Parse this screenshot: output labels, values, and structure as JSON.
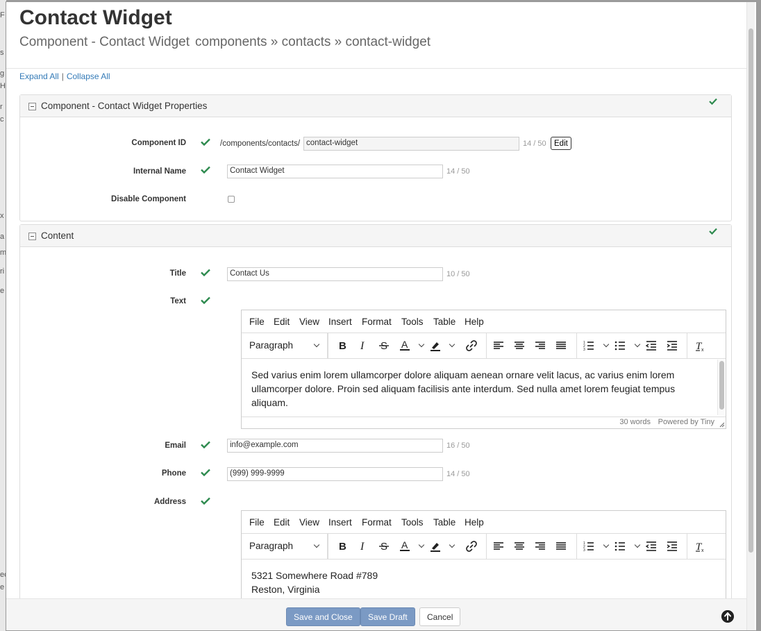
{
  "page": {
    "title": "Contact Widget",
    "subtitle_type": "Component - Contact Widget",
    "subtitle_path": "components » contacts » contact-widget"
  },
  "links": {
    "expand_all": "Expand All",
    "separator": "|",
    "collapse_all": "Collapse All"
  },
  "properties_panel": {
    "title": "Component - Contact Widget Properties",
    "component_id": {
      "label": "Component ID",
      "prefix": "/components/contacts/",
      "value": "contact-widget",
      "counter": "14 / 50",
      "edit_label": "Edit"
    },
    "internal_name": {
      "label": "Internal Name",
      "value": "Contact Widget",
      "counter": "14 / 50"
    },
    "disable_component": {
      "label": "Disable Component",
      "checked": false
    }
  },
  "content_panel": {
    "title": "Content",
    "title_field": {
      "label": "Title",
      "value": "Contact Us",
      "counter": "10 / 50"
    },
    "text_field": {
      "label": "Text",
      "body": "Sed varius enim lorem ullamcorper dolore aliquam aenean ornare velit lacus, ac varius enim lorem ullamcorper dolore. Proin sed aliquam facilisis ante interdum. Sed nulla amet lorem feugiat tempus aliquam.",
      "word_count": "30 words",
      "powered_by": "Powered by Tiny"
    },
    "email_field": {
      "label": "Email",
      "value": "info@example.com",
      "counter": "16 / 50"
    },
    "phone_field": {
      "label": "Phone",
      "value": "(999) 999-9999",
      "counter": "14 / 50"
    },
    "address_field": {
      "label": "Address",
      "line1": "5321 Somewhere Road #789",
      "line2": "Reston, Virginia"
    }
  },
  "editor": {
    "menu": [
      "File",
      "Edit",
      "View",
      "Insert",
      "Format",
      "Tools",
      "Table",
      "Help"
    ],
    "block_format": "Paragraph"
  },
  "footer": {
    "save_close": "Save and Close",
    "save_draft": "Save Draft",
    "cancel": "Cancel"
  },
  "colors": {
    "check": "#2d8a4e",
    "link": "#337ab7",
    "primary_button": "#7b9ac4"
  }
}
